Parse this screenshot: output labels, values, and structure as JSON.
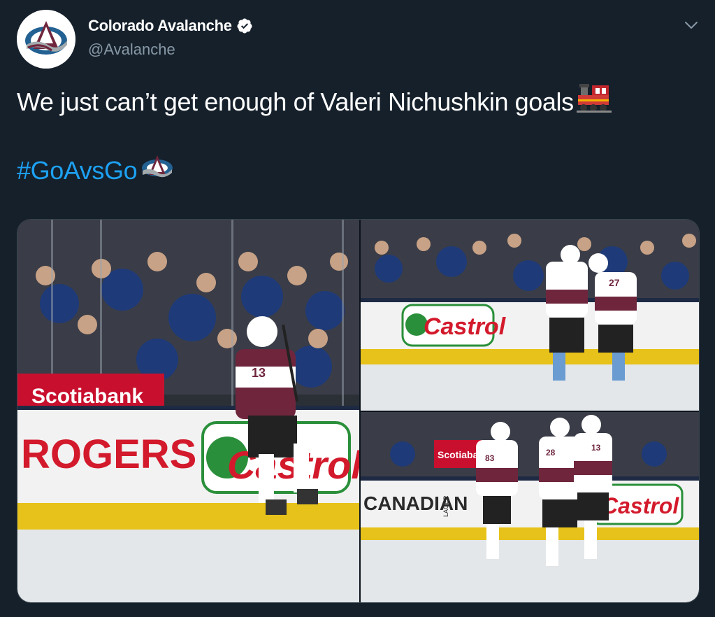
{
  "tweet": {
    "author": {
      "display_name": "Colorado Avalanche",
      "handle": "@Avalanche",
      "verified_icon": "verified-badge-icon",
      "avatar_icon": "avalanche-logo-icon"
    },
    "text_line1": "We just can’t get enough of Valeri Nichushkin goals",
    "text_line1_emoji": "train-emoji-icon",
    "hashtag": "#GoAvsGo",
    "hashtag_emoji": "avalanche-logo-icon",
    "menu_icon": "chevron-down-icon",
    "photos": [
      {
        "description_icon": "hockey-photo",
        "signage": [
          "ROGERS",
          "Castrol",
          "Scotiabank"
        ],
        "jersey_number": "13"
      },
      {
        "description_icon": "hockey-photo",
        "signage": [
          "Castrol"
        ],
        "jersey_numbers": [
          "27"
        ]
      },
      {
        "description_icon": "hockey-photo",
        "signage": [
          "CANADIAN",
          "LAGER",
          "Castrol",
          "Scotiabank"
        ],
        "jersey_numbers": [
          "83",
          "28",
          "13"
        ]
      }
    ]
  },
  "colors": {
    "background": "#15202b",
    "secondary_text": "#8899a6",
    "link": "#1da1f2",
    "avalanche_burgundy": "#6f263d",
    "avalanche_blue": "#236192"
  }
}
